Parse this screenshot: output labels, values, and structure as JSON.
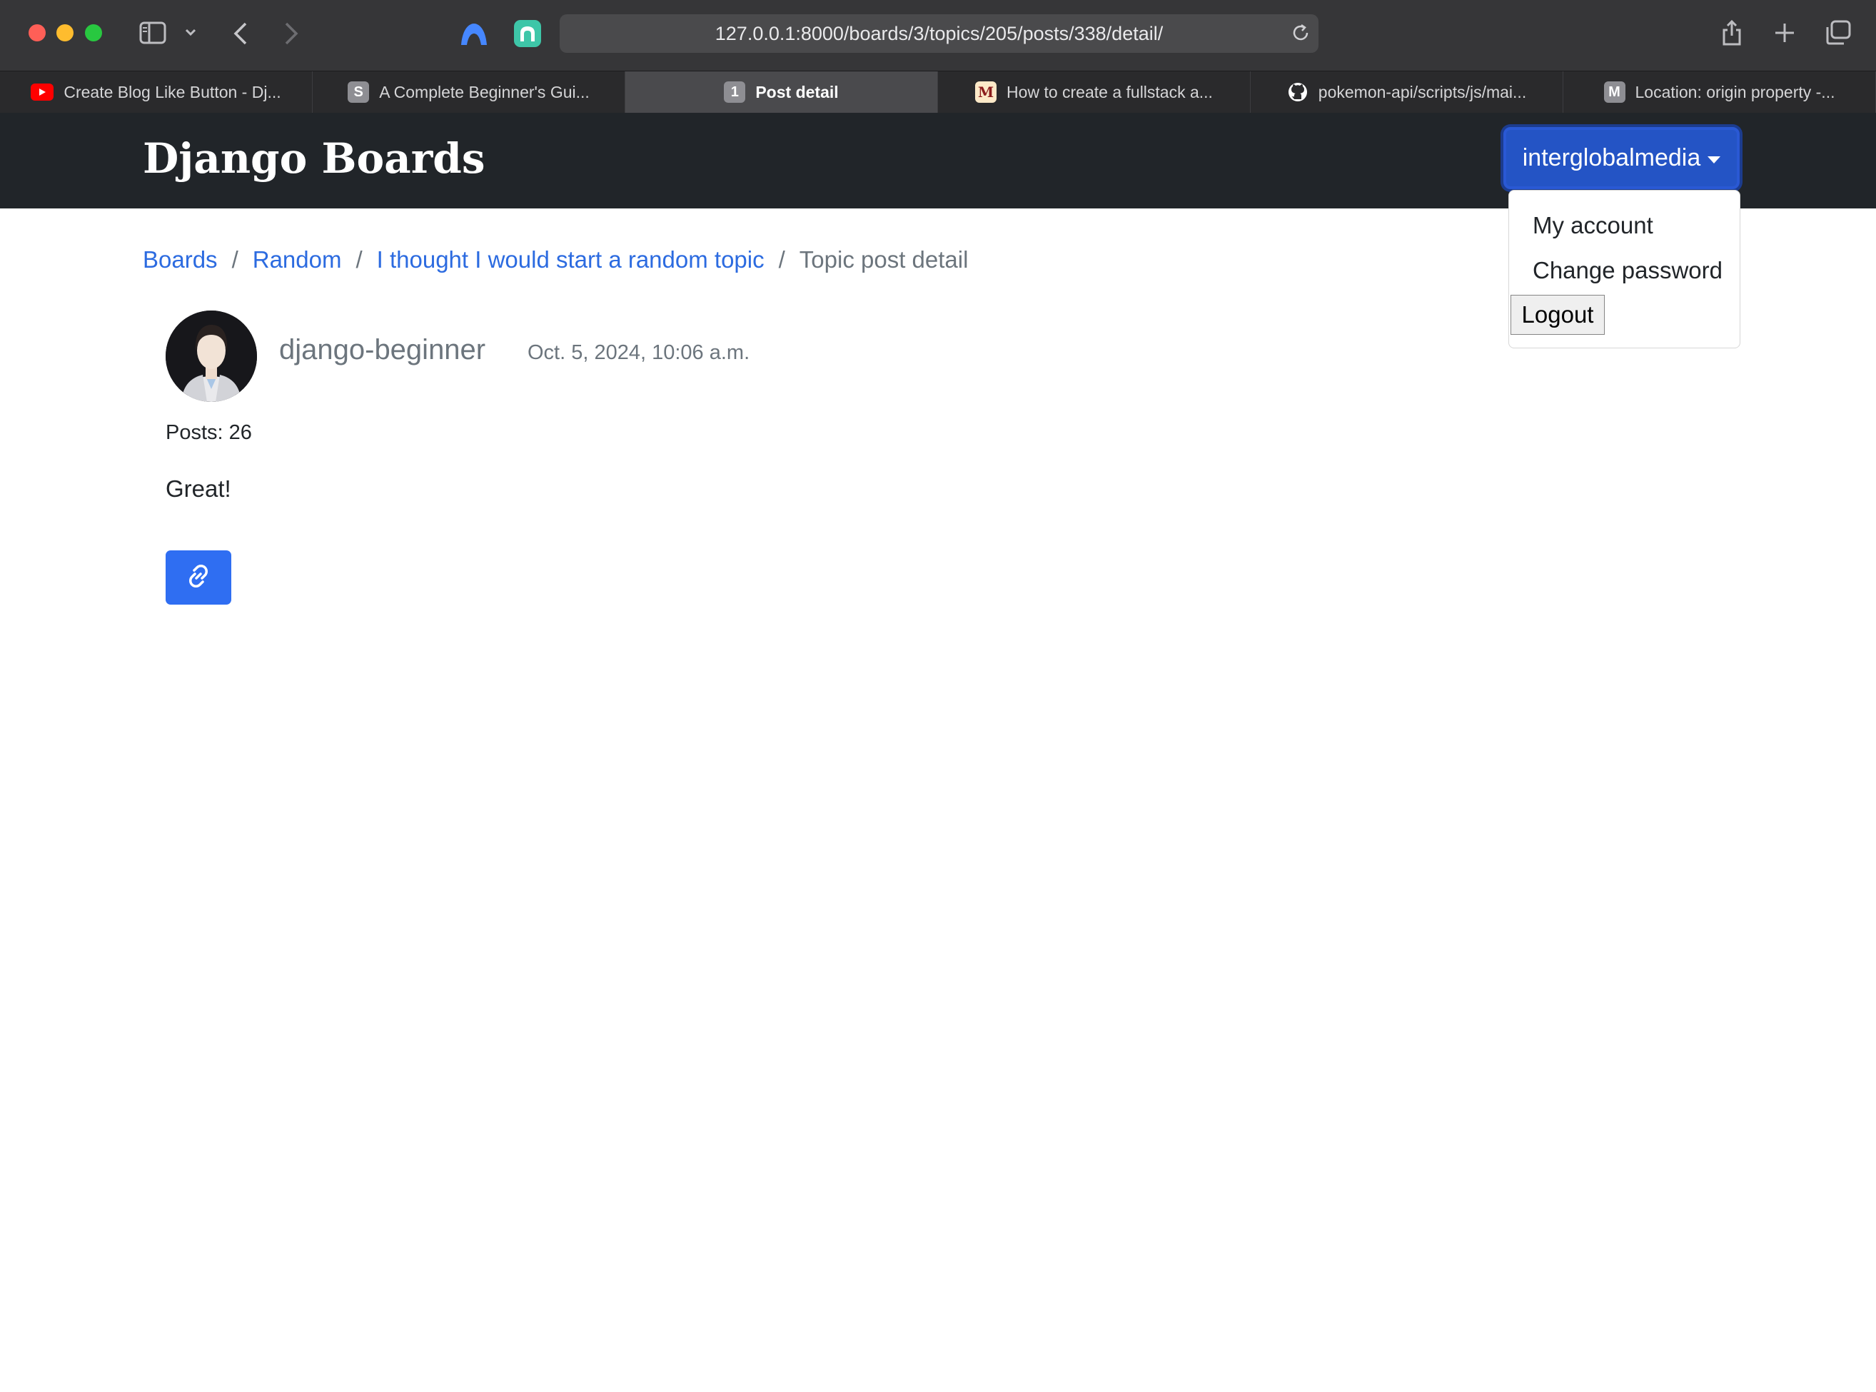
{
  "browser": {
    "url": "127.0.0.1:8000/boards/3/topics/205/posts/338/detail/",
    "tabs": [
      {
        "title": "Create Blog Like Button - Dj...",
        "icon": "youtube-icon"
      },
      {
        "title": "A Complete Beginner's Gui...",
        "favicon_letter": "S"
      },
      {
        "title": "Post detail",
        "favicon_letter": "1",
        "active": true
      },
      {
        "title": "How to create a fullstack a...",
        "favicon_letter": "M"
      },
      {
        "title": "pokemon-api/scripts/js/mai...",
        "icon": "github-icon"
      },
      {
        "title": "Location: origin property -...",
        "favicon_letter": "M"
      }
    ]
  },
  "navbar": {
    "brand": "Django Boards",
    "user_menu_label": "interglobalmedia",
    "dropdown": {
      "my_account": "My account",
      "change_password": "Change password",
      "logout": "Logout"
    }
  },
  "breadcrumb": {
    "items": [
      "Boards",
      "Random",
      "I thought I would start a random topic"
    ],
    "current": "Topic post detail",
    "separator": "/"
  },
  "post": {
    "author": "django-beginner",
    "date": "Oct. 5, 2024, 10:06 a.m.",
    "posts_count": "Posts: 26",
    "message": "Great!",
    "link_button_icon": "link-icon"
  },
  "colors": {
    "navbar_bg": "#212529",
    "primary": "#2f6ef2",
    "link": "#2c6be0",
    "muted": "#6c757d"
  }
}
